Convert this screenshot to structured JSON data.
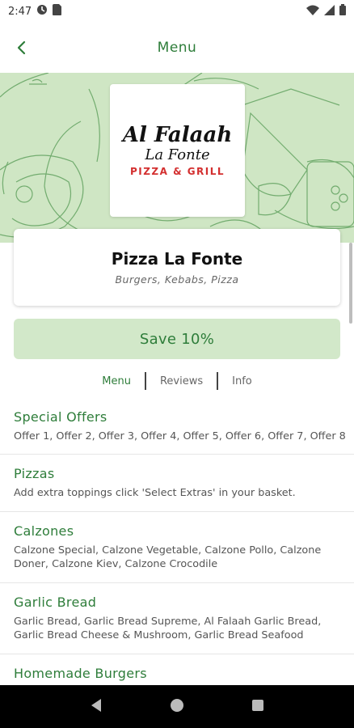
{
  "status_bar": {
    "time": "2:47"
  },
  "header": {
    "title": "Menu"
  },
  "logo": {
    "line1": "Al Falaah",
    "line2": "La Fonte",
    "tagline": "PIZZA & GRILL"
  },
  "restaurant": {
    "name": "Pizza La Fonte",
    "cuisines": "Burgers, Kebabs, Pizza"
  },
  "offer_button": {
    "label": "Save 10%"
  },
  "tabs": [
    {
      "label": "Menu",
      "active": true
    },
    {
      "label": "Reviews",
      "active": false
    },
    {
      "label": "Info",
      "active": false
    }
  ],
  "categories": [
    {
      "title": "Special Offers",
      "description": "Offer 1, Offer 2, Offer 3, Offer 4, Offer 5, Offer 6, Offer 7, Offer 8"
    },
    {
      "title": "Pizzas",
      "description": "Add extra toppings click 'Select Extras' in your basket."
    },
    {
      "title": "Calzones",
      "description": "Calzone Special, Calzone Vegetable, Calzone Pollo, Calzone Doner, Calzone Kiev, Calzone Crocodile"
    },
    {
      "title": "Garlic Bread",
      "description": "Garlic Bread, Garlic Bread Supreme, Al Falaah Garlic Bread, Garlic Bread Cheese & Mushroom, Garlic Bread Seafood"
    },
    {
      "title": "Homemade Burgers",
      "description": ""
    }
  ],
  "colors": {
    "accent": "#2e7d3a",
    "hero_bg": "#cfe6c4",
    "save_bg": "#d2e8c9",
    "logo_red": "#d32f2f"
  }
}
